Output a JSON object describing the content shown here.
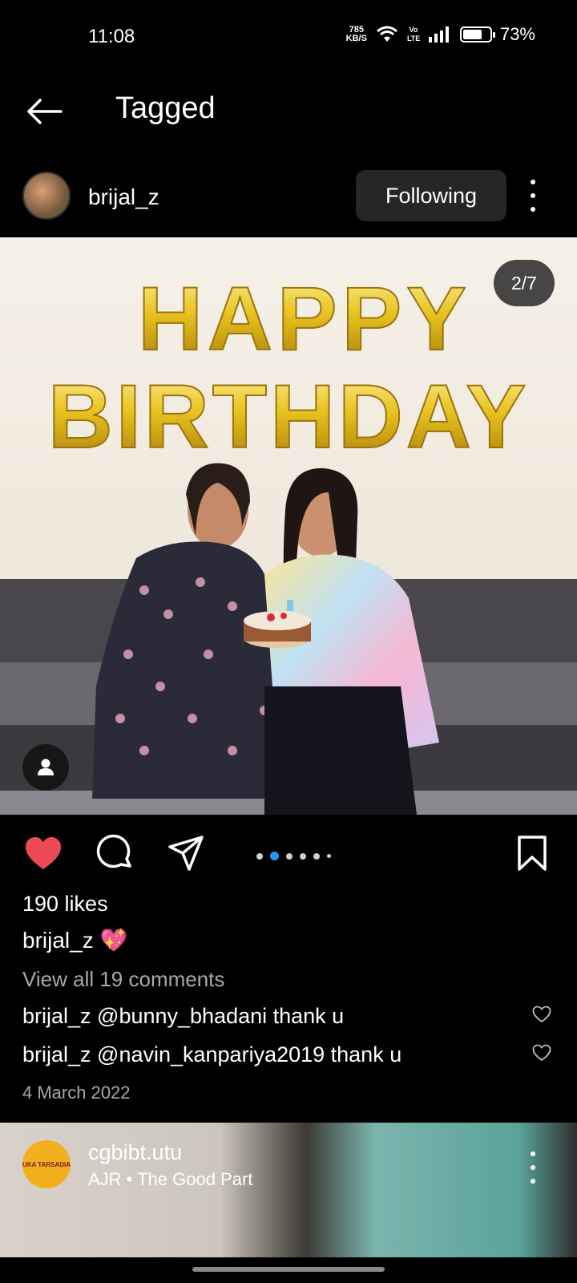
{
  "status_bar": {
    "time": "11:08",
    "net_speed_value": "785",
    "net_speed_unit": "KB/S",
    "volte": "Vo LTE",
    "battery": "73%",
    "battery_level": 0.73
  },
  "header": {
    "title": "Tagged"
  },
  "post": {
    "username": "brijal_z",
    "following_label": "Following",
    "carousel_counter": "2/7",
    "photo_banner_line1": "HAPPY",
    "photo_banner_line2": "BIRTHDAY",
    "likes": "190 likes",
    "caption": "brijal_z 💖",
    "view_comments": "View all 19 comments",
    "comments": [
      {
        "text": "brijal_z @bunny_bhadani thank u"
      },
      {
        "text": "brijal_z @navin_kanpariya2019 thank u"
      }
    ],
    "date": "4 March 2022",
    "carousel_active_index": 1
  },
  "next_post": {
    "username": "cgbibt.utu",
    "audio": "AJR • The Good Part",
    "avatar_text": "UKA TARSADIA"
  },
  "colors": {
    "like_red": "#ed4956",
    "carousel_active": "#2196f3",
    "button_bg": "#262626",
    "muted_text": "#a8a8a8"
  },
  "icons": {
    "back": "arrow-left",
    "like": "heart-filled",
    "comment": "speech-bubble",
    "share": "paper-plane",
    "save": "bookmark",
    "tag": "person",
    "more": "vertical-ellipsis"
  }
}
